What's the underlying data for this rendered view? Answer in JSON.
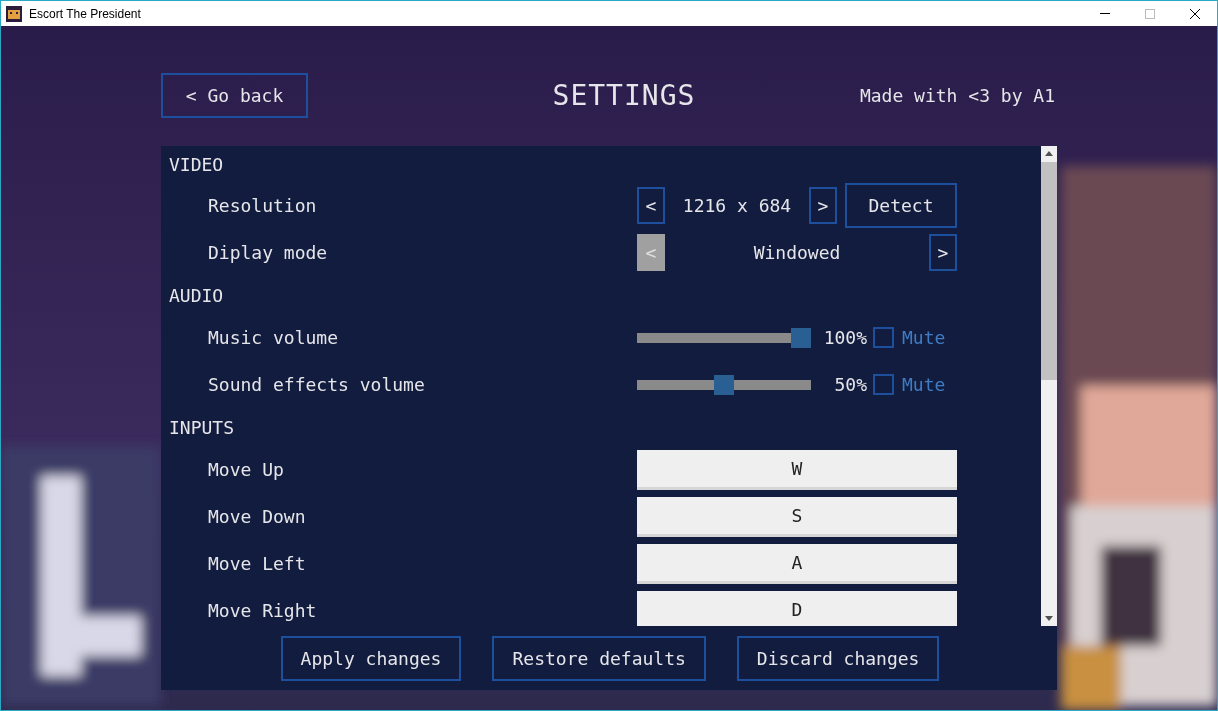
{
  "window": {
    "title": "Escort The President"
  },
  "header": {
    "back_button": "< Go back",
    "title": "SETTINGS",
    "credit": "Made with <3 by A1"
  },
  "sections": [
    {
      "title": "VIDEO",
      "rows": [
        {
          "kind": "stepper",
          "label": "Resolution",
          "value": "1216 x 684",
          "prev": {
            "label": "<",
            "disabled": false
          },
          "next": {
            "label": ">",
            "disabled": false
          },
          "action": "Detect"
        },
        {
          "kind": "stepper",
          "label": "Diplay mode",
          "value": "Windowed",
          "prev": {
            "label": "<",
            "disabled": true
          },
          "next": {
            "label": ">",
            "disabled": false
          }
        }
      ]
    },
    {
      "title": "AUDIO",
      "rows": [
        {
          "kind": "slider",
          "label": "Music volume",
          "level": 1,
          "reading": "100%",
          "mute": {
            "label": "Mute",
            "checked": false
          }
        },
        {
          "kind": "slider",
          "label": "Sound effects volume",
          "level": 0.5,
          "reading": "50%",
          "mute": {
            "label": "Mute",
            "checked": false
          }
        }
      ]
    },
    {
      "title": "INPUTS",
      "rows": [
        {
          "kind": "key",
          "label": "Move Up",
          "value": "W"
        },
        {
          "kind": "key",
          "label": "Move Down",
          "value": "S"
        },
        {
          "kind": "key",
          "label": "Move Left",
          "value": "A"
        },
        {
          "kind": "key",
          "label": "Move Right",
          "value": "D"
        }
      ]
    }
  ],
  "buttons": [
    "Apply changes",
    "Restore defaults",
    "Discard changes"
  ]
}
